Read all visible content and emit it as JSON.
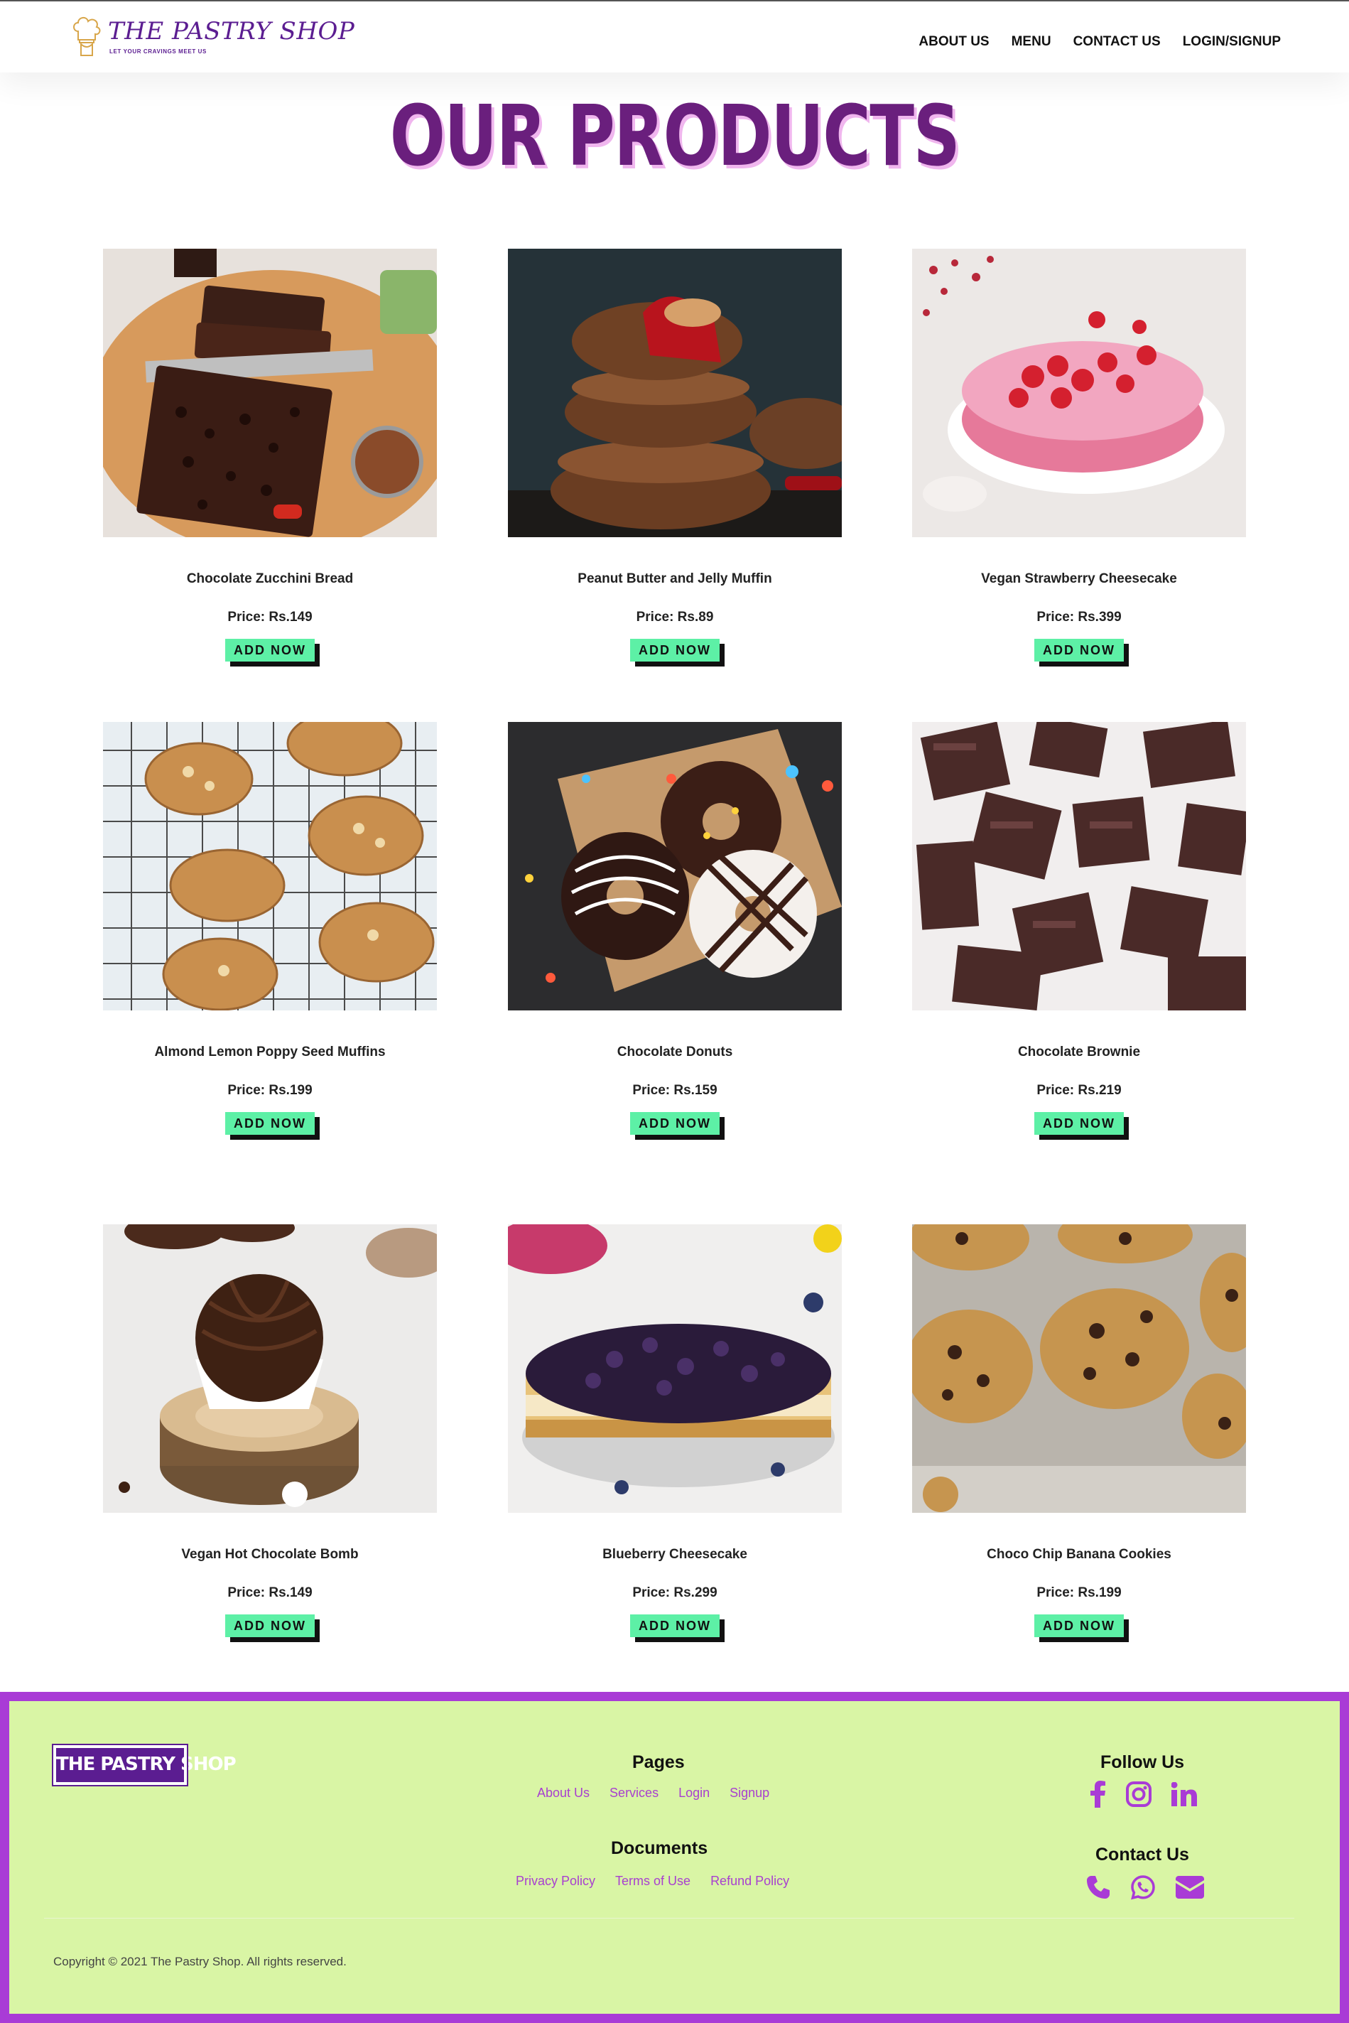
{
  "header": {
    "brand": "THE PASTRY SHOP",
    "tagline": "LET YOUR CRAVINGS MEET US",
    "nav": [
      "ABOUT US",
      "MENU",
      "CONTACT US",
      "LOGIN/SIGNUP"
    ]
  },
  "page_title": "OUR PRODUCTS",
  "products": [
    {
      "name": "Chocolate Zucchini Bread",
      "price": "Price: Rs.149",
      "button": "ADD NOW"
    },
    {
      "name": "Peanut Butter and Jelly Muffin",
      "price": "Price: Rs.89",
      "button": "ADD NOW"
    },
    {
      "name": "Vegan Strawberry Cheesecake",
      "price": "Price: Rs.399",
      "button": "ADD NOW"
    },
    {
      "name": "Almond Lemon Poppy Seed Muffins",
      "price": "Price: Rs.199",
      "button": "ADD NOW"
    },
    {
      "name": "Chocolate Donuts",
      "price": "Price: Rs.159",
      "button": "ADD NOW"
    },
    {
      "name": "Chocolate Brownie",
      "price": "Price: Rs.219",
      "button": "ADD NOW"
    },
    {
      "name": "Vegan Hot Chocolate Bomb",
      "price": "Price: Rs.149",
      "button": "ADD NOW"
    },
    {
      "name": "Blueberry Cheesecake",
      "price": "Price: Rs.299",
      "button": "ADD NOW"
    },
    {
      "name": "Choco Chip Banana Cookies",
      "price": "Price: Rs.199",
      "button": "ADD NOW"
    }
  ],
  "footer": {
    "logo_text": "THE PASTRY SHOP",
    "pages_heading": "Pages",
    "pages_links": [
      "About Us",
      "Services",
      "Login",
      "Signup"
    ],
    "documents_heading": "Documents",
    "documents_links": [
      "Privacy Policy",
      "Terms of Use",
      "Refund Policy"
    ],
    "follow_heading": "Follow Us",
    "social_icons": [
      "facebook-icon",
      "instagram-icon",
      "linkedin-icon"
    ],
    "contact_heading": "Contact Us",
    "contact_icons": [
      "phone-icon",
      "whatsapp-icon",
      "envelope-icon"
    ],
    "copyright": "Copyright © 2021 The Pastry Shop. All rights reserved."
  },
  "colors": {
    "brand_purple": "#5b1d91",
    "title_purple": "#6a1f7d",
    "button_green": "#5df0a6",
    "footer_bg": "#d9f5a5",
    "footer_border": "#a93bd6",
    "link_purple": "#a83fd0"
  }
}
